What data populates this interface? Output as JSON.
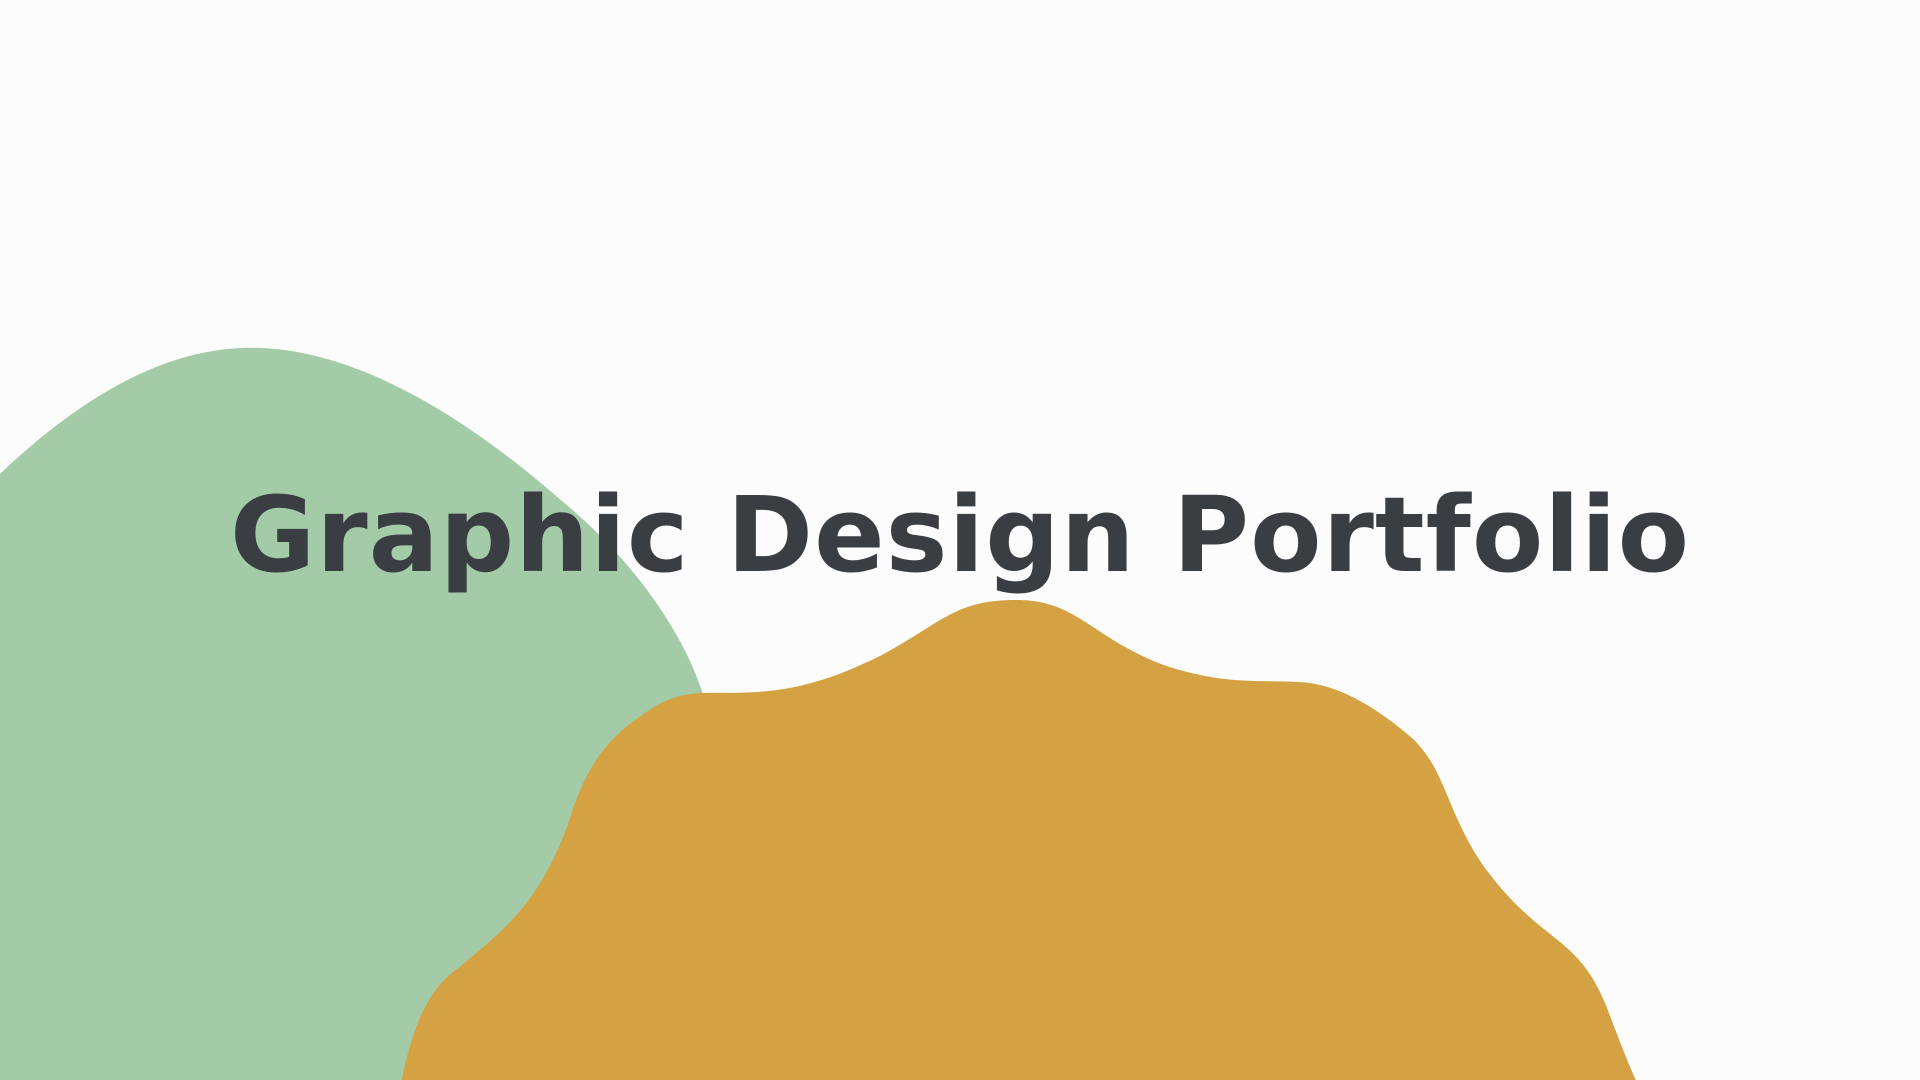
{
  "slide": {
    "title": "Graphic Design Portfolio"
  },
  "colors": {
    "background": "#fcfcfc",
    "green_blob": "#a4cba8",
    "orange_blob": "#d4a242",
    "title_text": "#3a3e42"
  }
}
